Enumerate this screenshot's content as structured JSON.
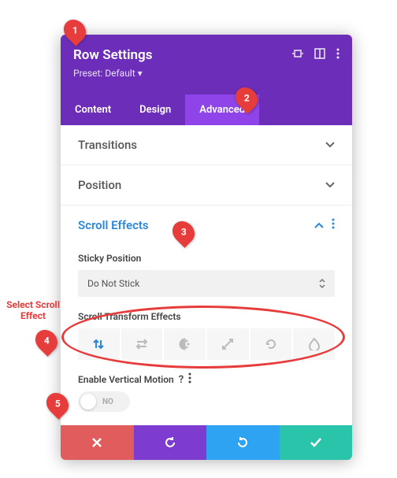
{
  "header": {
    "title": "Row Settings",
    "preset": "Preset: Default ▾"
  },
  "tabs": {
    "content": "Content",
    "design": "Design",
    "advanced": "Advanced"
  },
  "acc": {
    "transitions": "Transitions",
    "position": "Position",
    "scrollEffects": "Scroll Effects"
  },
  "fields": {
    "stickyPosition": "Sticky Position",
    "stickyValue": "Do Not Stick",
    "transformEffects": "Scroll Transform Effects",
    "enableVertical": "Enable Vertical Motion",
    "toggleLabel": "NO"
  },
  "annotation": {
    "selectLine1": "Select Scroll",
    "selectLine2": "Effect",
    "m1": "1",
    "m2": "2",
    "m3": "3",
    "m4": "4",
    "m5": "5"
  }
}
